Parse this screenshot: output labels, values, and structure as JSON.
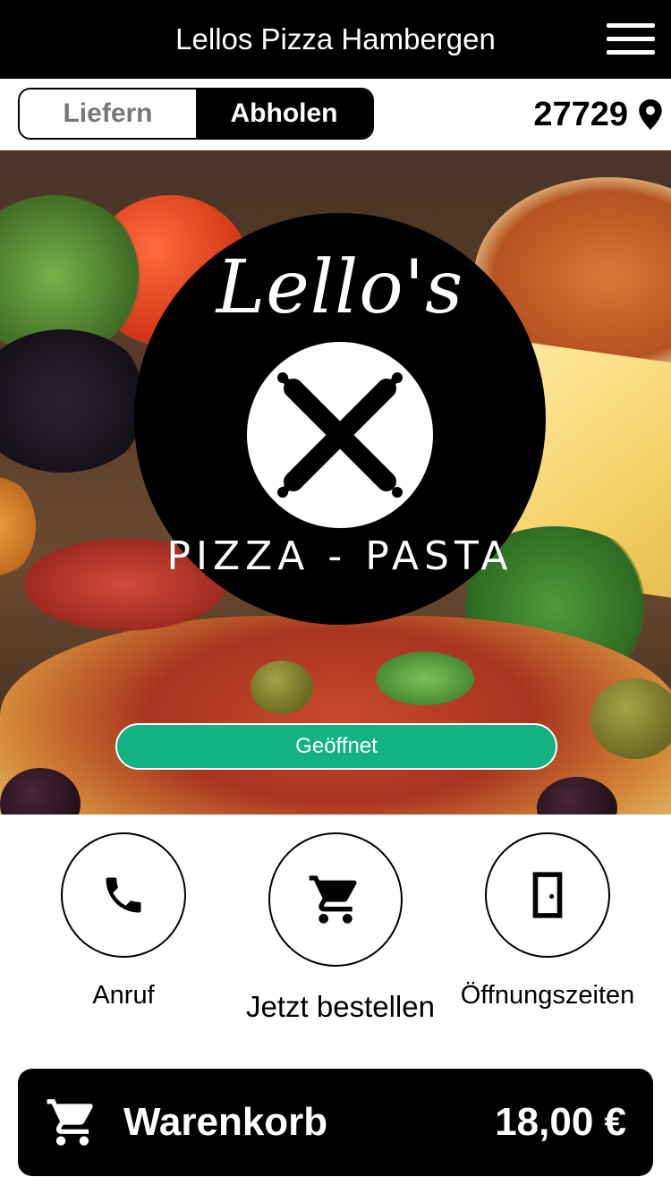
{
  "header": {
    "title": "Lellos Pizza Hambergen"
  },
  "mode": {
    "options": [
      "Liefern",
      "Abholen"
    ],
    "selected": "Abholen"
  },
  "location": {
    "zip": "27729"
  },
  "hero": {
    "logo": {
      "script_text": "Lello's",
      "subtitle": "PIZZA - PASTA"
    },
    "status": "Geöffnet"
  },
  "actions": [
    {
      "label": "Anruf",
      "icon": "phone-icon"
    },
    {
      "label": "Jetzt bestellen",
      "icon": "cart-icon"
    },
    {
      "label": "Öffnungszeiten",
      "icon": "door-icon"
    }
  ],
  "cart": {
    "label": "Warenkorb",
    "total": "18,00 €"
  },
  "colors": {
    "header_bg": "#000000",
    "status_green": "#13b281",
    "inactive_text": "#777777"
  }
}
